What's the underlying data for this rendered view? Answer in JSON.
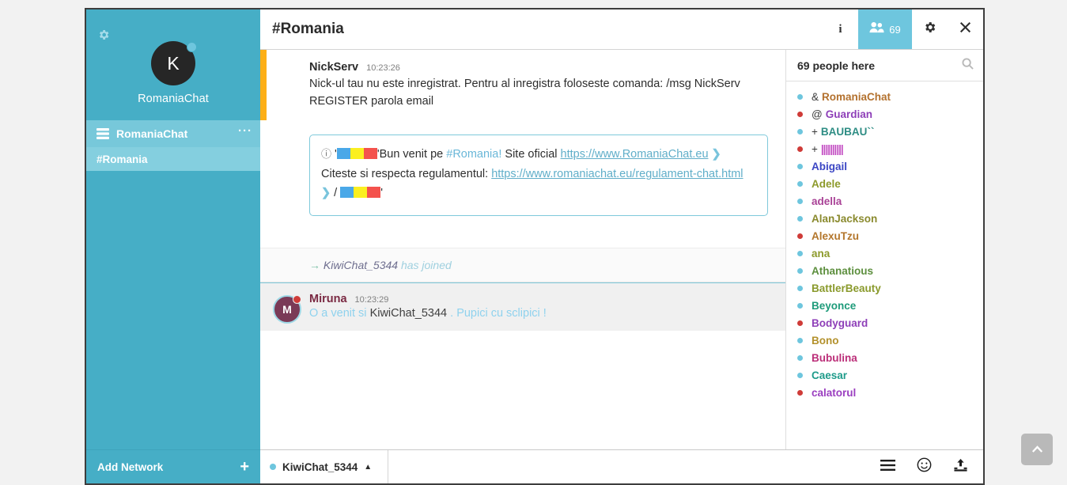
{
  "sidebar": {
    "gear_icon": "gear-icon",
    "avatar_initial": "K",
    "username": "RomaniaChat",
    "network": {
      "name": "RomaniaChat",
      "more_label": "···",
      "icon": "server-icon"
    },
    "channels": [
      {
        "label": "#Romania"
      }
    ],
    "add_network": {
      "label": "Add Network",
      "plus": "+"
    }
  },
  "topbar": {
    "title": "#Romania",
    "info_label": "i",
    "people_count": "69",
    "gear_icon": "gear-icon",
    "close_icon": "close-icon"
  },
  "messages": {
    "nickserv": {
      "nick": "NickServ",
      "time": "10:23:26",
      "text": "Nick-ul tau nu este inregistrat. Pentru al inregistra foloseste comanda: /msg NickServ REGISTER parola email"
    },
    "topic": {
      "info_icon": "info-icon",
      "quote_open": "'",
      "seg1": "'Bun venit pe ",
      "channel": "#Romania!",
      "seg2": " Site oficial ",
      "link1": "https://www.RomaniaChat.eu",
      "seg3": "Citeste si respecta regulamentul: ",
      "link2a": "https://www.romaniachat.eu/regulament-chat.",
      "link2b": "html",
      "sep": " / ",
      "quote_close": "'"
    },
    "join": {
      "arrow": "→",
      "nick": "KiwiChat_5344",
      "text": "has joined"
    },
    "miruna": {
      "avatar_initial": "M",
      "nick": "Miruna",
      "time": "10:23:29",
      "text_before": "O a venit si ",
      "mention": "KiwiChat_5344",
      "text_after": " . Pupici cu sclipici !"
    }
  },
  "userlist": {
    "header": "69 people here",
    "search_icon": "search-icon",
    "users": [
      {
        "prefix": "&",
        "name": "RomaniaChat",
        "color": "#b3712e",
        "dot": "#6ec6de"
      },
      {
        "prefix": "@",
        "name": "Guardian",
        "color": "#8e3fb8",
        "dot": "#cf3b38"
      },
      {
        "prefix": "+",
        "name": "BAUBAU``",
        "color": "#2e8d84",
        "dot": "#6ec6de"
      },
      {
        "prefix": "+",
        "name": "||||||||||",
        "color": "#c24bc2",
        "dot": "#cf3b38"
      },
      {
        "prefix": "",
        "name": "Abigail",
        "color": "#3b46c4",
        "dot": "#6ec6de"
      },
      {
        "prefix": "",
        "name": "Adele",
        "color": "#8d9a2b",
        "dot": "#6ec6de"
      },
      {
        "prefix": "",
        "name": "adella",
        "color": "#a94296",
        "dot": "#6ec6de"
      },
      {
        "prefix": "",
        "name": "AlanJackson",
        "color": "#8a8a2e",
        "dot": "#6ec6de"
      },
      {
        "prefix": "",
        "name": "AlexuTzu",
        "color": "#b3762c",
        "dot": "#cf3b38"
      },
      {
        "prefix": "",
        "name": "ana",
        "color": "#8d9a2b",
        "dot": "#6ec6de"
      },
      {
        "prefix": "",
        "name": "Athanatious",
        "color": "#5d8f3e",
        "dot": "#6ec6de"
      },
      {
        "prefix": "",
        "name": "BattlerBeauty",
        "color": "#8a9a2c",
        "dot": "#6ec6de"
      },
      {
        "prefix": "",
        "name": "Beyonce",
        "color": "#1e9b7a",
        "dot": "#6ec6de"
      },
      {
        "prefix": "",
        "name": "Bodyguard",
        "color": "#8e3fb8",
        "dot": "#cf3b38"
      },
      {
        "prefix": "",
        "name": "Bono",
        "color": "#b3912c",
        "dot": "#6ec6de"
      },
      {
        "prefix": "",
        "name": "Bubulina",
        "color": "#bb2e78",
        "dot": "#6ec6de"
      },
      {
        "prefix": "",
        "name": "Caesar",
        "color": "#1e9b8a",
        "dot": "#6ec6de"
      },
      {
        "prefix": "",
        "name": "calatorul",
        "color": "#9b3fc0",
        "dot": "#cf3b38"
      }
    ]
  },
  "inputbar": {
    "nick": "KiwiChat_5344",
    "caret": "▲",
    "message_value": "",
    "message_placeholder": "",
    "menu_icon": "hamburger-menu-icon",
    "emoji_icon": "smiley-face-icon",
    "upload_icon": "upload-icon"
  },
  "scrolltop": {
    "icon": "chevron-up-icon"
  }
}
